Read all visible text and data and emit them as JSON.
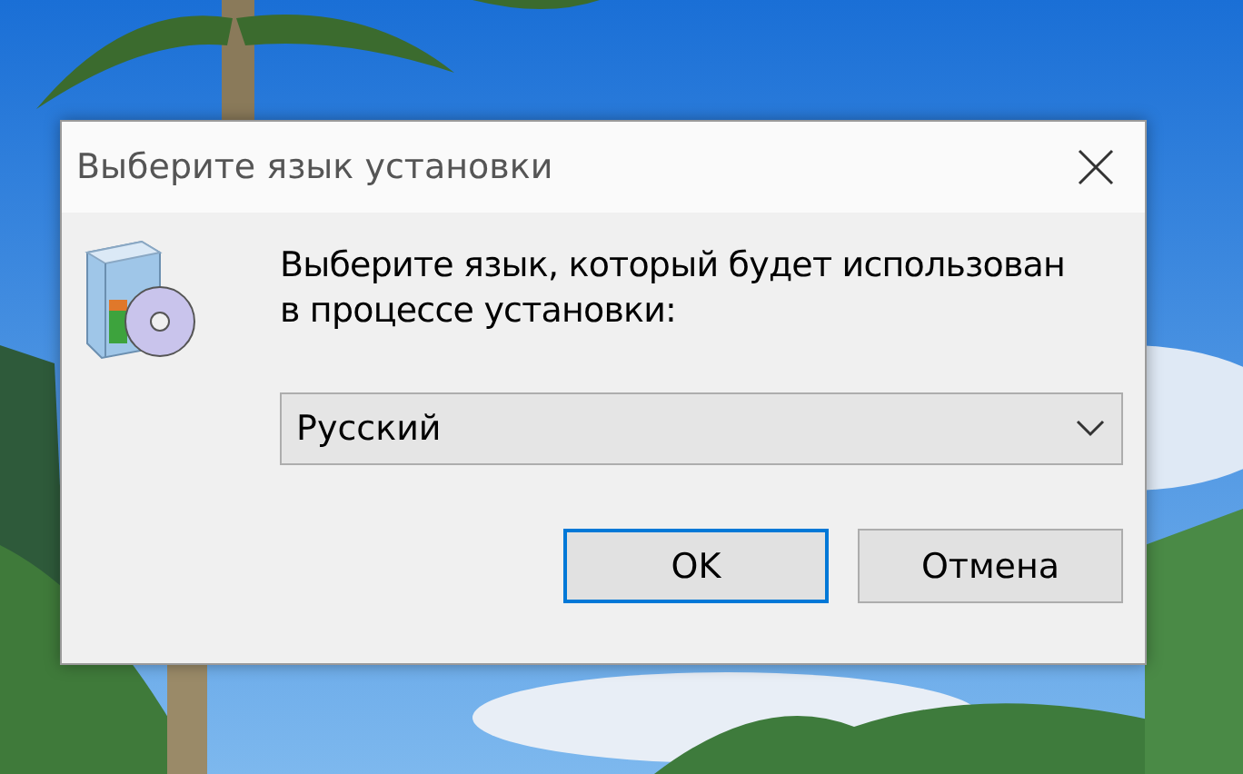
{
  "window": {
    "title": "Выберите язык установки"
  },
  "message": "Выберите язык, который будет использован в  процессе установки:",
  "language_dropdown": {
    "value": "Русский"
  },
  "buttons": [
    {
      "label": "OK",
      "focused": true
    },
    {
      "label": "Отмена",
      "focused": false
    }
  ]
}
